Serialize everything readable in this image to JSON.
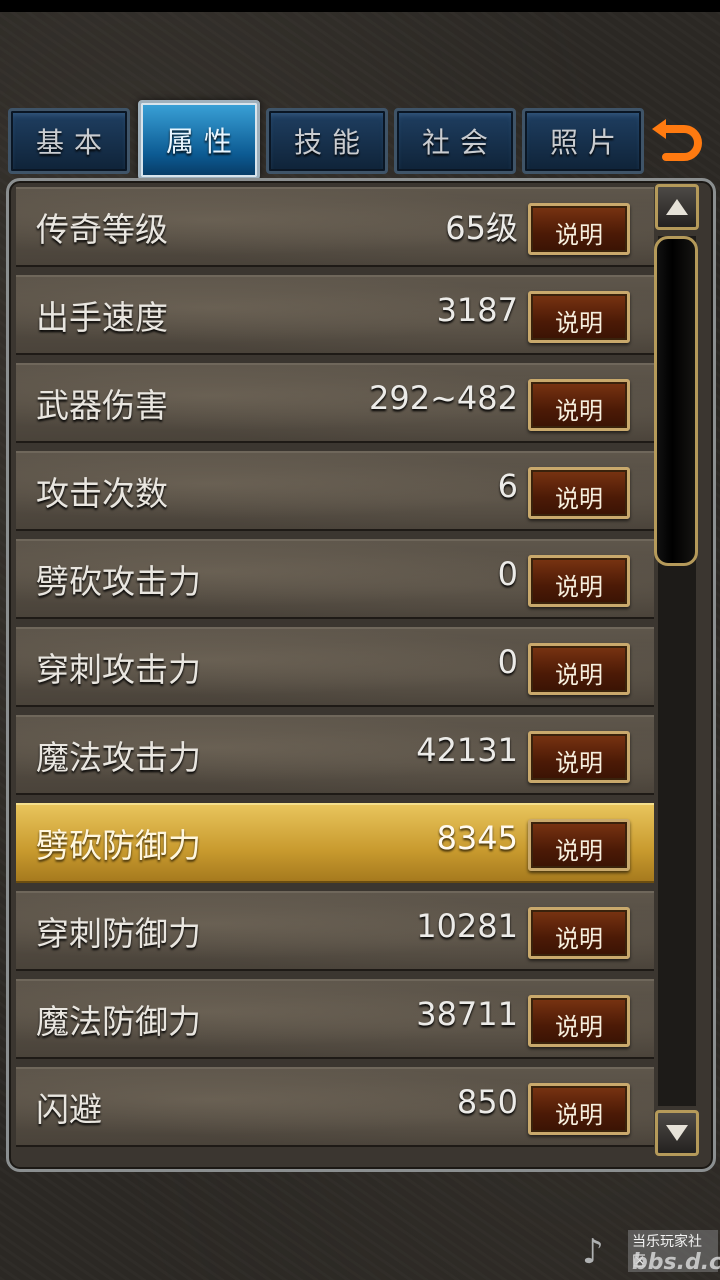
{
  "tabs": [
    {
      "label": "基本",
      "active": false
    },
    {
      "label": "属性",
      "active": true
    },
    {
      "label": "技能",
      "active": false
    },
    {
      "label": "社会",
      "active": false
    },
    {
      "label": "照片",
      "active": false
    }
  ],
  "back_icon": "undo-arrow-icon",
  "rows": [
    {
      "label": "传奇等级",
      "value": "65级",
      "button": "说明"
    },
    {
      "label": "出手速度",
      "value": "3187",
      "button": "说明"
    },
    {
      "label": "武器伤害",
      "value": "292~482",
      "button": "说明"
    },
    {
      "label": "攻击次数",
      "value": "6",
      "button": "说明"
    },
    {
      "label": "劈砍攻击力",
      "value": "0",
      "button": "说明"
    },
    {
      "label": "穿刺攻击力",
      "value": "0",
      "button": "说明"
    },
    {
      "label": "魔法攻击力",
      "value": "42131",
      "button": "说明"
    },
    {
      "label": "劈砍防御力",
      "value": "8345",
      "button": "说明"
    },
    {
      "label": "穿刺防御力",
      "value": "10281",
      "button": "说明"
    },
    {
      "label": "魔法防御力",
      "value": "38711",
      "button": "说明"
    },
    {
      "label": "闪避",
      "value": "850",
      "button": "说明"
    }
  ],
  "selected_row": 7,
  "colors": {
    "accent_tab": "#1a7fc0",
    "selected_row": "#d8ad3e",
    "button": "#5a2008"
  },
  "watermark": {
    "top": "当乐玩家社区",
    "bottom": "bbs.d.cn"
  }
}
